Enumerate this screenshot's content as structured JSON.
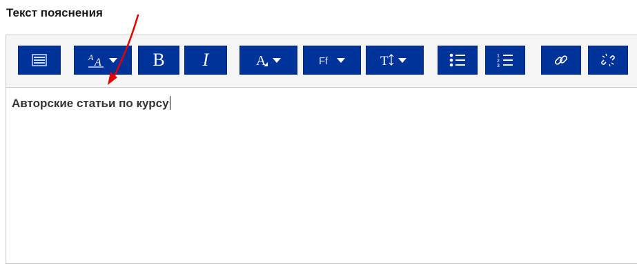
{
  "field": {
    "label": "Текст пояснения"
  },
  "toolbar": {
    "buttons": [
      {
        "name": "toggle-toolbar-button",
        "icon": "toolbar-toggle-icon"
      },
      {
        "name": "font-style-button",
        "icon": "font-style-dropdown-icon"
      },
      {
        "name": "bold-button",
        "icon": "bold-icon",
        "label": "B"
      },
      {
        "name": "italic-button",
        "icon": "italic-icon",
        "label": "I"
      },
      {
        "name": "font-color-button",
        "icon": "font-color-dropdown-icon"
      },
      {
        "name": "font-family-button",
        "icon": "font-family-dropdown-icon",
        "label": "Ff"
      },
      {
        "name": "font-size-button",
        "icon": "font-size-dropdown-icon"
      },
      {
        "name": "unordered-list-button",
        "icon": "bullet-list-icon"
      },
      {
        "name": "ordered-list-button",
        "icon": "numbered-list-icon"
      },
      {
        "name": "link-button",
        "icon": "link-icon"
      },
      {
        "name": "unlink-button",
        "icon": "unlink-icon"
      }
    ]
  },
  "editor": {
    "content": "Авторские статьи по курсу"
  },
  "colors": {
    "button": "#00339a",
    "annotation_arrow": "#e00000"
  }
}
